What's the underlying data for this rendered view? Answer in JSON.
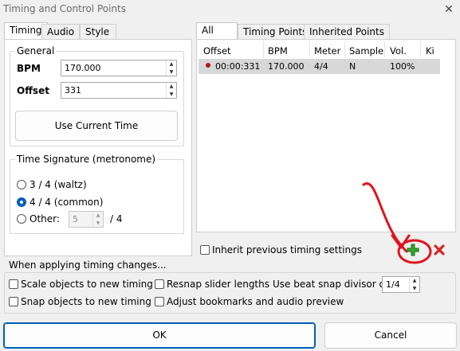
{
  "window": {
    "title": "Timing and Control Points",
    "close_icon": "close-icon"
  },
  "left_tabs": [
    "Timing",
    "Audio",
    "Style"
  ],
  "general": {
    "legend": "General",
    "bpm_label": "BPM",
    "bpm_value": "170.000",
    "offset_label": "Offset",
    "offset_value": "331",
    "use_current_time": "Use Current Time"
  },
  "time_signature": {
    "legend": "Time Signature (metronome)",
    "options": [
      "3 / 4 (waltz)",
      "4 / 4 (common)",
      "Other:"
    ],
    "selected": "4 / 4 (common)",
    "other_value": "5",
    "other_suffix": "/ 4"
  },
  "right_tabs": [
    "All",
    "Timing Points",
    "Inherited Points"
  ],
  "table": {
    "columns": [
      "Offset",
      "BPM",
      "Meter",
      "Sample",
      "Vol.",
      "Ki"
    ],
    "rows": [
      {
        "offset": "00:00:331",
        "bpm": "170.000",
        "meter": "4/4",
        "sample": "N",
        "vol": "100%"
      }
    ]
  },
  "inherit_label": "Inherit previous timing settings",
  "add_icon": "plus-icon",
  "delete_icon": "delete-icon",
  "apply_section": {
    "header": "When applying timing changes...",
    "scale_objects": "Scale objects to new timing",
    "snap_objects": "Snap objects to new timing",
    "resnap_sliders": "Resnap slider lengths",
    "adjust_bookmarks": "Adjust bookmarks and audio preview",
    "beat_snap_label": "Use beat snap divisor of",
    "beat_snap_value": "1/4"
  },
  "buttons": {
    "ok": "OK",
    "cancel": "Cancel"
  },
  "colors": {
    "accent": "#005fb8",
    "annotation": "#e0141e",
    "add_green": "#2ea82e"
  }
}
